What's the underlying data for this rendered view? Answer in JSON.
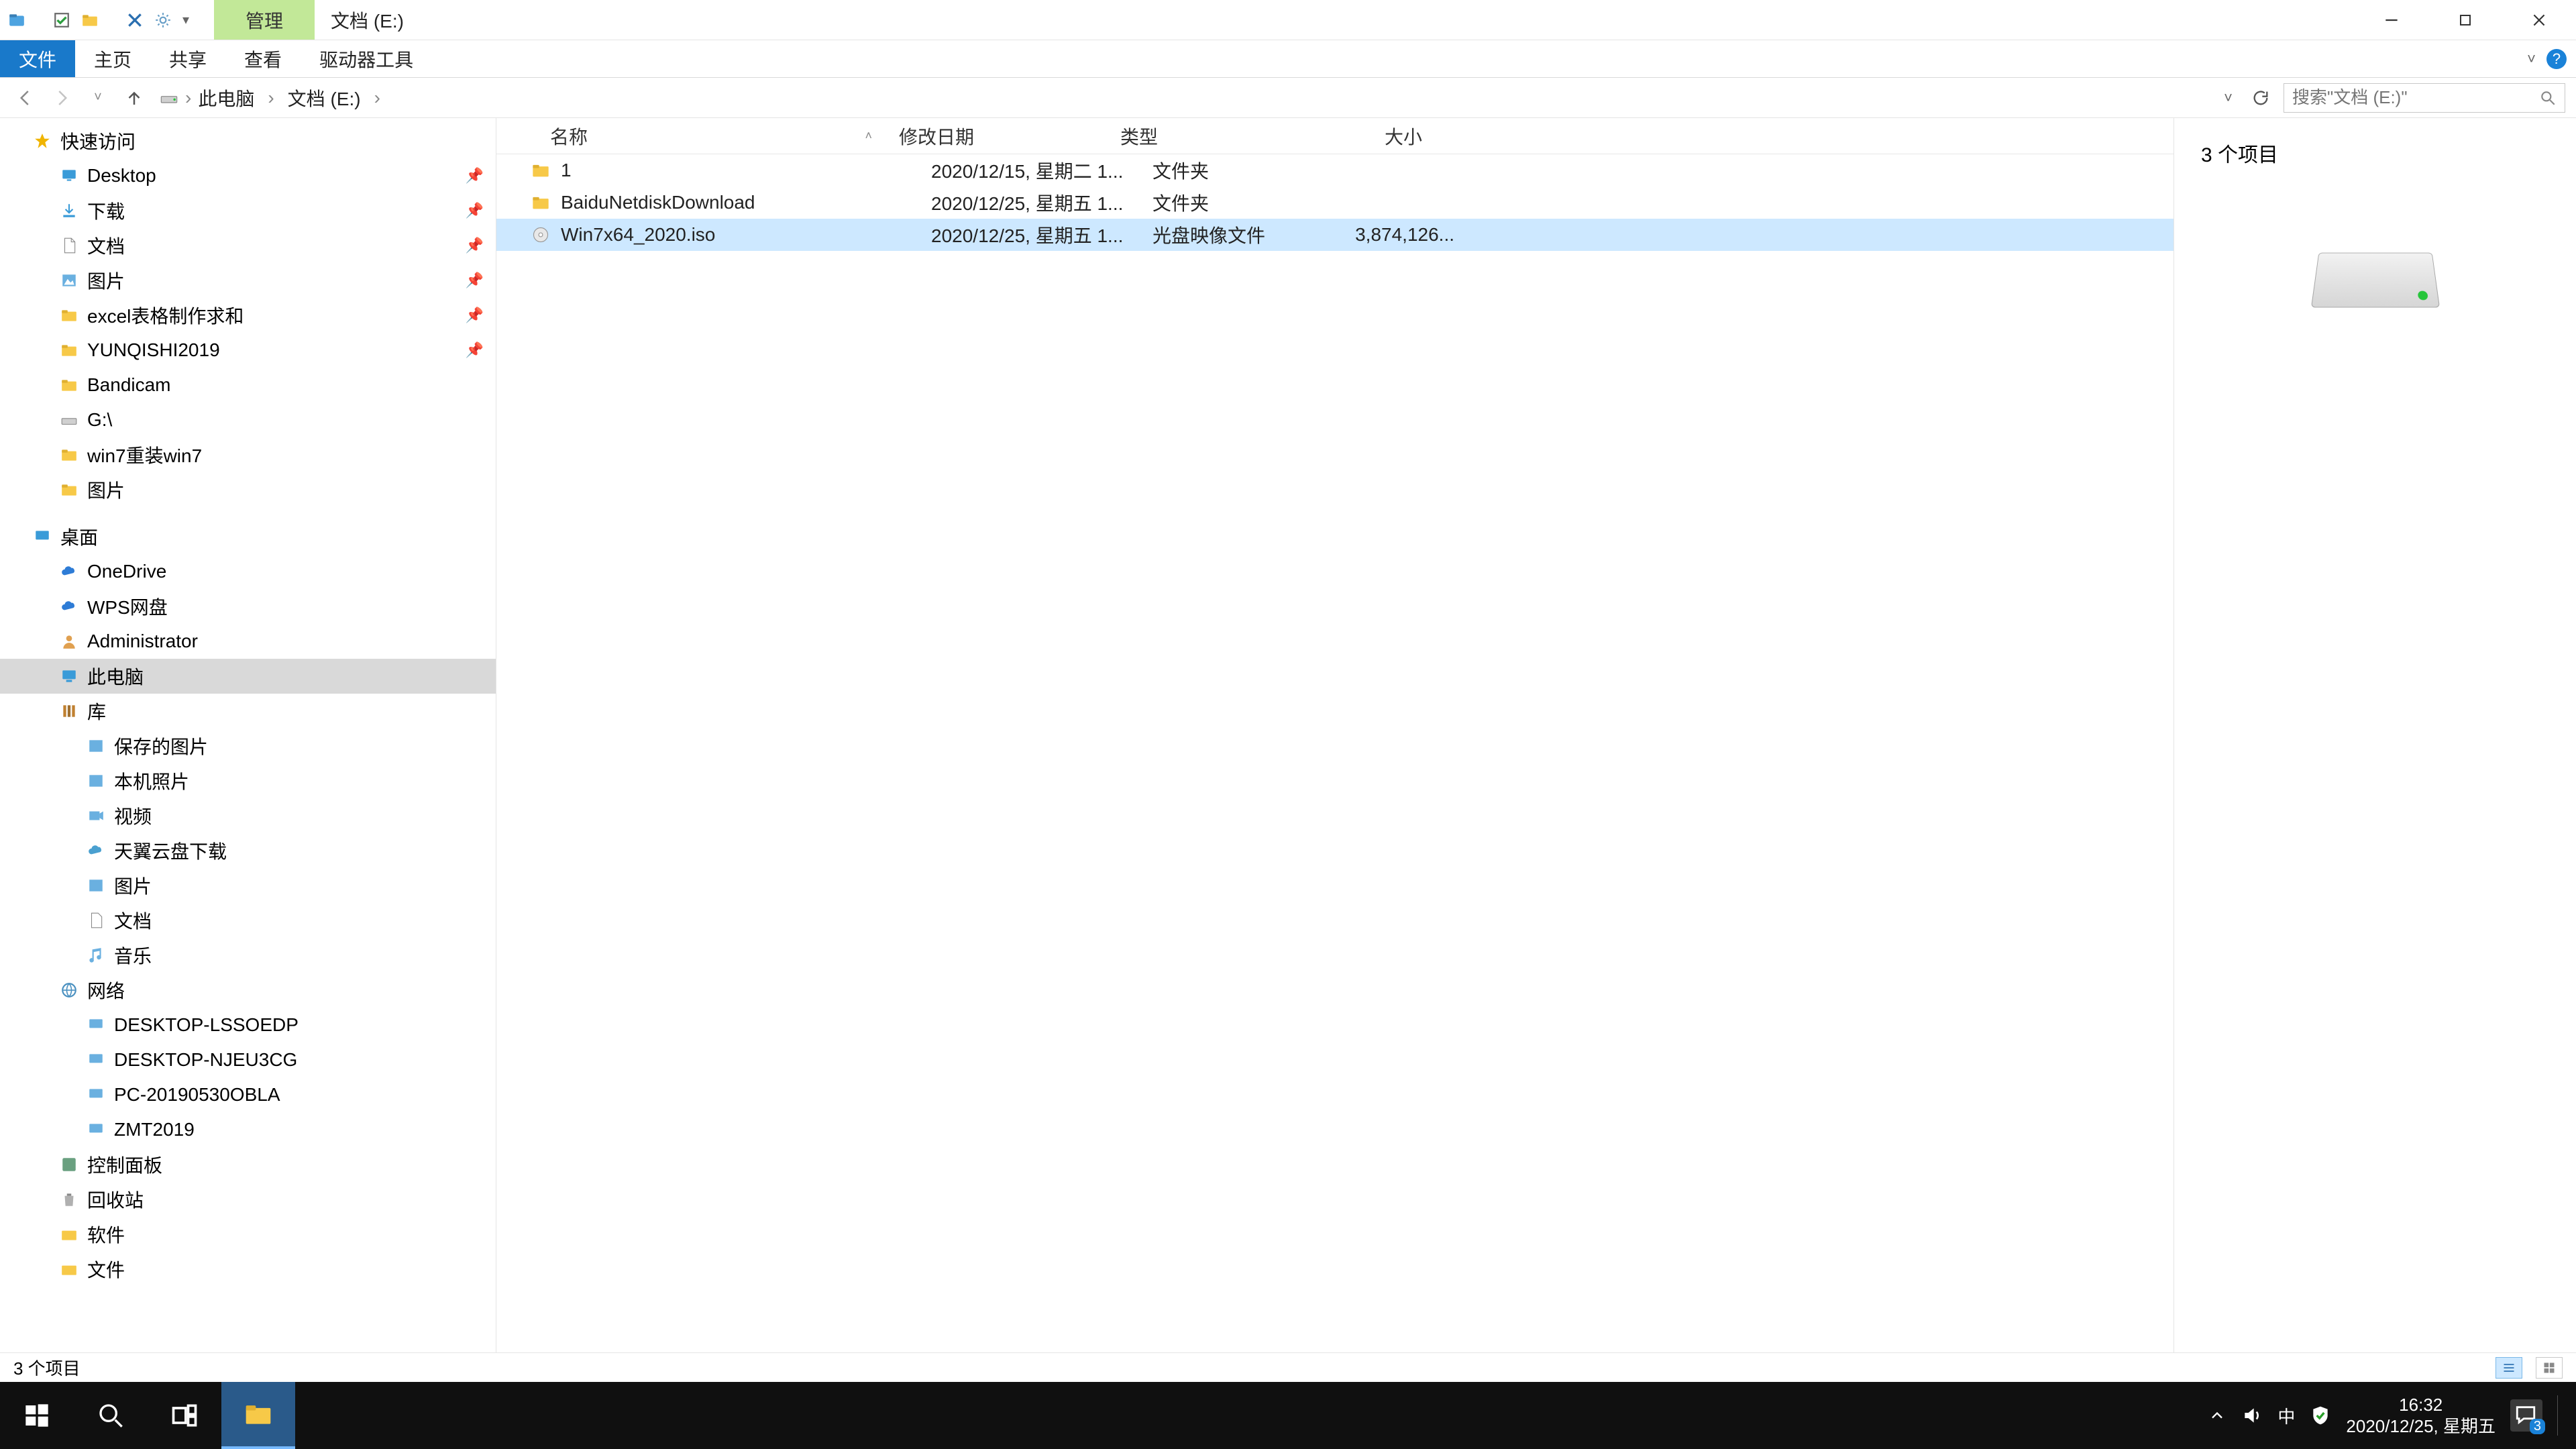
{
  "titlebar": {
    "contextual_tab": "管理",
    "location": "文档 (E:)"
  },
  "ribbon": {
    "file": "文件",
    "home": "主页",
    "share": "共享",
    "view": "查看",
    "drive_tools": "驱动器工具"
  },
  "breadcrumb": {
    "seg0": "此电脑",
    "seg1": "文档 (E:)"
  },
  "search": {
    "placeholder": "搜索\"文档 (E:)\""
  },
  "tree": {
    "quick_access": "快速访问",
    "desktop_qa": "Desktop",
    "downloads": "下载",
    "documents": "文档",
    "pictures_qa": "图片",
    "excel": "excel表格制作求和",
    "yunqishi": "YUNQISHI2019",
    "bandicam": "Bandicam",
    "g_drive": "G:\\",
    "win7": "win7重装win7",
    "pictures2": "图片",
    "desktop": "桌面",
    "onedrive": "OneDrive",
    "wps": "WPS网盘",
    "admin": "Administrator",
    "this_pc": "此电脑",
    "libraries": "库",
    "saved_pics": "保存的图片",
    "camera": "本机照片",
    "videos": "视频",
    "tianyi": "天翼云盘下载",
    "pictures_lib": "图片",
    "documents_lib": "文档",
    "music": "音乐",
    "network": "网络",
    "net1": "DESKTOP-LSSOEDP",
    "net2": "DESKTOP-NJEU3CG",
    "net3": "PC-20190530OBLA",
    "net4": "ZMT2019",
    "control_panel": "控制面板",
    "recycle": "回收站",
    "software": "软件",
    "files_folder": "文件"
  },
  "columns": {
    "name": "名称",
    "date": "修改日期",
    "type": "类型",
    "size": "大小"
  },
  "rows": [
    {
      "name": "1",
      "date": "2020/12/15, 星期二 1...",
      "type": "文件夹",
      "size": "",
      "kind": "folder",
      "selected": false
    },
    {
      "name": "BaiduNetdiskDownload",
      "date": "2020/12/25, 星期五 1...",
      "type": "文件夹",
      "size": "",
      "kind": "folder",
      "selected": false
    },
    {
      "name": "Win7x64_2020.iso",
      "date": "2020/12/25, 星期五 1...",
      "type": "光盘映像文件",
      "size": "3,874,126...",
      "kind": "iso",
      "selected": true
    }
  ],
  "preview": {
    "count_label": "3 个项目"
  },
  "status": {
    "text": "3 个项目"
  },
  "taskbar": {
    "ime": "中",
    "time": "16:32",
    "date": "2020/12/25, 星期五",
    "notif_count": "3"
  }
}
